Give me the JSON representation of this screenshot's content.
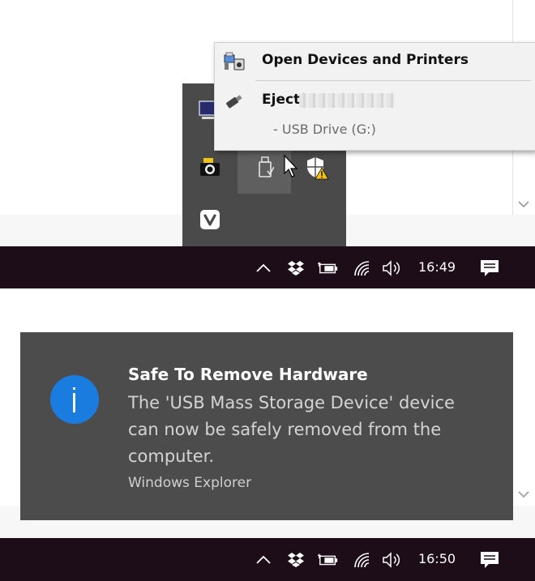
{
  "context_menu": {
    "open_devices_label": "Open Devices and Printers",
    "eject_label": "Eject",
    "sub_item": "-   USB Drive (G:)"
  },
  "taskbar_top": {
    "clock": "16:49"
  },
  "taskbar_bottom": {
    "clock": "16:50"
  },
  "toast": {
    "title": "Safe To Remove Hardware",
    "body": "The 'USB Mass Storage Device' device can now be safely removed from the computer.",
    "source": "Windows Explorer"
  },
  "colors": {
    "taskbar_bg": "#1d0d19",
    "toast_bg": "#4c4c4c",
    "info_blue": "#1b7cdf",
    "menu_bg": "#f2f2f2"
  },
  "icons": {
    "context_menu": [
      "devices-printers-icon",
      "usb-eject-icon"
    ],
    "tray_flyout": [
      "monitor-icon",
      "camera-icon",
      "usb-drive-icon",
      "security-warning-icon",
      "vivaldi-icon"
    ],
    "taskbar": [
      "chevron-up-icon",
      "dropbox-icon",
      "battery-icon",
      "wifi-icon",
      "volume-icon",
      "notification-icon"
    ],
    "toast": [
      "info-icon"
    ]
  }
}
